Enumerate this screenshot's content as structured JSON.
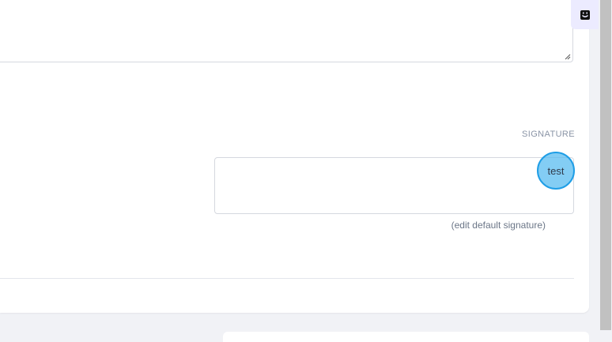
{
  "signature": {
    "label": "SIGNATURE",
    "value": "test",
    "edit_link": "(edit default signature)"
  },
  "widget": {
    "icon": "chat-face-icon"
  }
}
